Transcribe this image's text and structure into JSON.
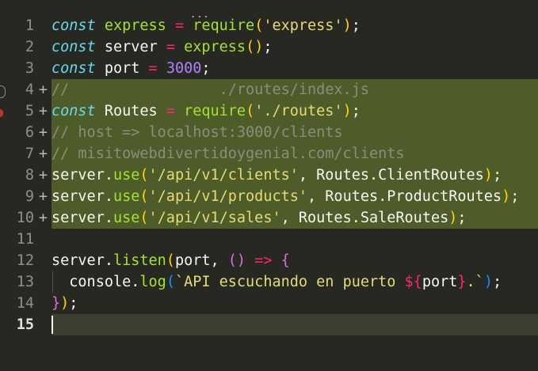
{
  "editor": {
    "lines": [
      {
        "num": "1",
        "mark": "",
        "tokens": [
          [
            "kw",
            "const"
          ],
          [
            "pn",
            " "
          ],
          [
            "fn",
            "express"
          ],
          [
            "pn",
            " "
          ],
          [
            "op",
            "="
          ],
          [
            "pn",
            " "
          ],
          [
            "fn",
            "require"
          ],
          [
            "br1",
            "("
          ],
          [
            "str",
            "'express'"
          ],
          [
            "br1",
            ")"
          ],
          [
            "pn",
            ";"
          ]
        ]
      },
      {
        "num": "2",
        "mark": "",
        "tokens": [
          [
            "kw",
            "const"
          ],
          [
            "pn",
            " server "
          ],
          [
            "op",
            "="
          ],
          [
            "pn",
            " "
          ],
          [
            "fn",
            "express"
          ],
          [
            "br1",
            "()"
          ],
          [
            "pn",
            ";"
          ]
        ]
      },
      {
        "num": "3",
        "mark": "",
        "tokens": [
          [
            "kw",
            "const"
          ],
          [
            "pn",
            " port "
          ],
          [
            "op",
            "="
          ],
          [
            "pn",
            " "
          ],
          [
            "num-c",
            "3000"
          ],
          [
            "pn",
            ";"
          ]
        ]
      },
      {
        "num": "4",
        "mark": "+",
        "tokens": [
          [
            "cm",
            "//                 ./routes/index.js"
          ]
        ]
      },
      {
        "num": "5",
        "mark": "+",
        "tokens": [
          [
            "kw",
            "const"
          ],
          [
            "pn",
            " Routes "
          ],
          [
            "op",
            "="
          ],
          [
            "pn",
            " "
          ],
          [
            "fn",
            "require"
          ],
          [
            "br1",
            "("
          ],
          [
            "str",
            "'./routes'"
          ],
          [
            "br1",
            ")"
          ],
          [
            "pn",
            ";"
          ]
        ]
      },
      {
        "num": "6",
        "mark": "+",
        "tokens": [
          [
            "cm",
            "// host => localhost:3000/clients"
          ]
        ]
      },
      {
        "num": "7",
        "mark": "+",
        "tokens": [
          [
            "cm",
            "// misitowebdivertidoygenial.com/clients"
          ]
        ]
      },
      {
        "num": "8",
        "mark": "+",
        "tokens": [
          [
            "pn",
            "server."
          ],
          [
            "fn",
            "use"
          ],
          [
            "br1",
            "("
          ],
          [
            "str",
            "'/api/v1/clients'"
          ],
          [
            "pn",
            ", Routes.ClientRoutes"
          ],
          [
            "br1",
            ")"
          ],
          [
            "pn",
            ";"
          ]
        ]
      },
      {
        "num": "9",
        "mark": "+",
        "tokens": [
          [
            "pn",
            "server."
          ],
          [
            "fn",
            "use"
          ],
          [
            "br1",
            "("
          ],
          [
            "str",
            "'/api/v1/products'"
          ],
          [
            "pn",
            ", Routes.ProductRoutes"
          ],
          [
            "br1",
            ")"
          ],
          [
            "pn",
            ";"
          ]
        ]
      },
      {
        "num": "10",
        "mark": "+",
        "tokens": [
          [
            "pn",
            "server."
          ],
          [
            "fn",
            "use"
          ],
          [
            "br1",
            "("
          ],
          [
            "str",
            "'/api/v1/sales'"
          ],
          [
            "pn",
            ", Routes.SaleRoutes"
          ],
          [
            "br1",
            ")"
          ],
          [
            "pn",
            ";"
          ]
        ]
      },
      {
        "num": "11",
        "mark": "",
        "tokens": []
      },
      {
        "num": "12",
        "mark": "",
        "tokens": [
          [
            "pn",
            "server."
          ],
          [
            "fn",
            "listen"
          ],
          [
            "br1",
            "("
          ],
          [
            "pn",
            "port, "
          ],
          [
            "br2",
            "()"
          ],
          [
            "pn",
            " "
          ],
          [
            "op",
            "=>"
          ],
          [
            "pn",
            " "
          ],
          [
            "br2",
            "{"
          ]
        ]
      },
      {
        "num": "13",
        "mark": "",
        "tokens": [
          [
            "pn",
            "  console."
          ],
          [
            "fn",
            "log"
          ],
          [
            "br3",
            "("
          ],
          [
            "tpl",
            "`API escuchando en puerto "
          ],
          [
            "op",
            "${"
          ],
          [
            "pn",
            "port"
          ],
          [
            "op",
            "}"
          ],
          [
            "tpl",
            ".`"
          ],
          [
            "br3",
            ")"
          ],
          [
            "pn",
            ";"
          ]
        ]
      },
      {
        "num": "14",
        "mark": "",
        "tokens": [
          [
            "br2",
            "}"
          ],
          [
            "br1",
            ")"
          ],
          [
            "pn",
            ";"
          ]
        ]
      },
      {
        "num": "15",
        "mark": "",
        "tokens": []
      }
    ],
    "highlighted_lines": [
      4,
      5,
      6,
      7,
      8,
      9,
      10
    ],
    "current_line": 15,
    "hint_dots": "..."
  }
}
